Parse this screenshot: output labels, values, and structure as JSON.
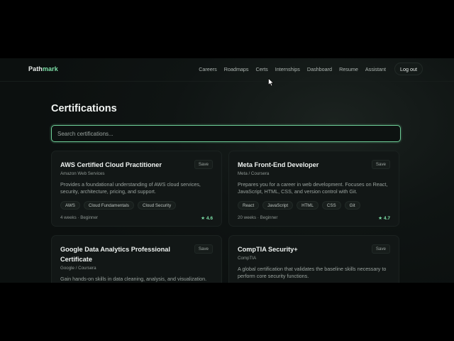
{
  "brand": {
    "prefix": "Path",
    "suffix": "mark"
  },
  "nav": {
    "links": [
      "Careers",
      "Roadmaps",
      "Certs",
      "Internships",
      "Dashboard",
      "Resume",
      "Assistant"
    ],
    "logout_label": "Log out"
  },
  "page": {
    "title": "Certifications"
  },
  "search": {
    "placeholder": "Search certifications..."
  },
  "colors": {
    "accent": "#7ee0a8",
    "background": "#0f1413",
    "card": "#121716"
  },
  "cards": [
    {
      "title": "AWS Certified Cloud Practitioner",
      "issuer": "Amazon Web Services",
      "save_label": "Save",
      "description": "Provides a foundational understanding of AWS cloud services, security, architecture, pricing, and support.",
      "tags": [
        "AWS",
        "Cloud Fundamentals",
        "Cloud Security"
      ],
      "meta": "4 weeks · Beginner",
      "rating": "★ 4.6"
    },
    {
      "title": "Meta Front-End Developer",
      "issuer": "Meta / Coursera",
      "save_label": "Save",
      "description": "Prepares you for a career in web development. Focuses on React, JavaScript, HTML, CSS, and version control with Git.",
      "tags": [
        "React",
        "JavaScript",
        "HTML",
        "CSS",
        "Git"
      ],
      "meta": "20 weeks · Beginner",
      "rating": "★ 4.7"
    },
    {
      "title": "Google Data Analytics Professional Certificate",
      "issuer": "Google / Coursera",
      "save_label": "Save",
      "description": "Gain hands-on skills in data cleaning, analysis, and visualization."
    },
    {
      "title": "CompTIA Security+",
      "issuer": "CompTIA",
      "save_label": "Save",
      "description": "A global certification that validates the baseline skills necessary to perform core security functions."
    }
  ]
}
